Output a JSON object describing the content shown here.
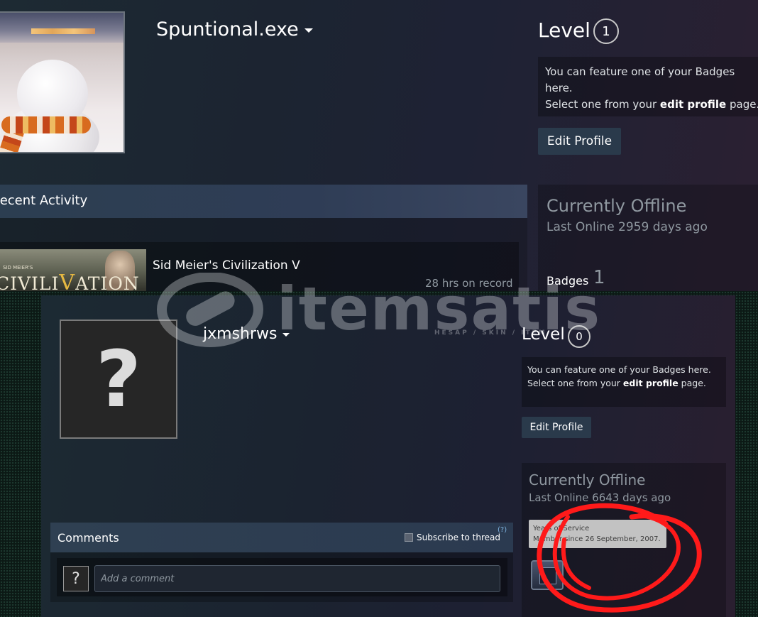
{
  "top_profile": {
    "username": "Spuntional.exe",
    "level_label": "Level",
    "level_value": "1",
    "badge_line1": "You can feature one of your Badges here.",
    "badge_line2_pre": "Select one from your ",
    "badge_line2_link": "edit profile",
    "badge_line2_post": " page.",
    "edit_profile": "Edit Profile",
    "recent_activity_title": "Recent Activity",
    "game_name": "Sid Meier's Civilization V",
    "game_hours": "28 hrs on record",
    "game_capsule_small": "SID MEIER'S",
    "game_capsule_text": "CIVILI",
    "game_capsule_v": "V",
    "game_capsule_end": "ATION",
    "status": "Currently Offline",
    "last_online": "Last Online 2959 days ago",
    "badges_label": "Badges",
    "badges_count": "1"
  },
  "bottom_profile": {
    "username": "jxmshrws",
    "avatar_placeholder": "?",
    "level_label": "Level",
    "level_value": "0",
    "badge_line1": "You can feature one of your Badges here.",
    "badge_line2_pre": "Select one from your ",
    "badge_line2_link": "edit profile",
    "badge_line2_post": " page.",
    "edit_profile": "Edit Profile",
    "status": "Currently Offline",
    "last_online": "Last Online 6643 days ago",
    "tooltip_line1": "Years of Service",
    "tooltip_line2": "Member since 26 September, 2007.",
    "comments_title": "Comments",
    "subscribe_label": "Subscribe to thread",
    "help_label": "(?)",
    "comment_avatar": "?",
    "comment_placeholder": "Add a comment"
  },
  "watermark": {
    "brand": "itemsatis",
    "tagline": "HESAP / SKIN / ITEM"
  },
  "colors": {
    "annotation": "#ff1a1a",
    "button_bg": "#2a3a4b",
    "muted_text": "#8f98a0"
  }
}
